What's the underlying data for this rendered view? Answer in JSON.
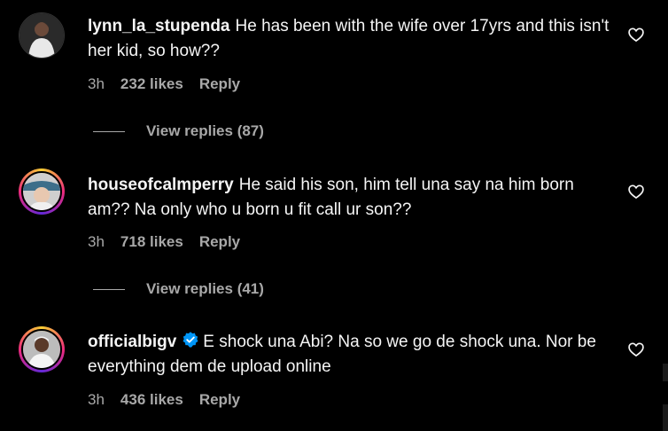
{
  "comments": [
    {
      "username": "lynn_la_stupenda",
      "text": "He has been with the wife over 17yrs and this isn't her kid, so how??",
      "time": "3h",
      "likes": "232 likes",
      "reply_label": "Reply",
      "view_replies": "View replies (87)",
      "verified": false,
      "avatar_ring": false,
      "icons": {
        "like": "heart-outline-icon"
      }
    },
    {
      "username": "houseofcalmperry",
      "text": "He said his son, him tell una say na him born am?? Na only who u born u fit call ur son??",
      "time": "3h",
      "likes": "718 likes",
      "reply_label": "Reply",
      "view_replies": "View replies (41)",
      "verified": false,
      "avatar_ring": true,
      "icons": {
        "like": "heart-outline-icon"
      }
    },
    {
      "username": "officialbigv",
      "text": "E shock una Abi? Na so we go de shock una. Nor be everything dem de upload online",
      "time": "3h",
      "likes": "436 likes",
      "reply_label": "Reply",
      "verified": true,
      "avatar_ring": true,
      "icons": {
        "like": "heart-outline-icon",
        "verified": "verified-badge-icon"
      }
    }
  ],
  "colors": {
    "background": "#000000",
    "text": "#f5f5f5",
    "secondary": "#a8a8a8",
    "verified": "#0095f6"
  }
}
